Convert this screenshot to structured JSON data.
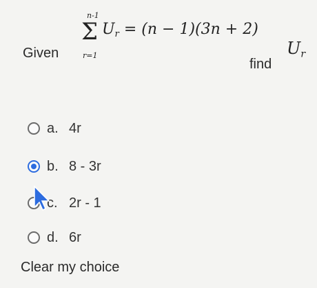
{
  "question": {
    "given_label": "Given",
    "sum_upper": "n-1",
    "sum_symbol": "Σ",
    "sum_lower": "r=1",
    "expression_term": "U",
    "expression_sub": "r",
    "expression_rhs": "= (n − 1)(3n + 2)",
    "find_label": "find",
    "target_term": "U",
    "target_sub": "r"
  },
  "options": [
    {
      "letter": "a.",
      "text": "4r",
      "selected": false
    },
    {
      "letter": "b.",
      "text": "8 - 3r",
      "selected": true
    },
    {
      "letter": "c.",
      "text": "2r - 1",
      "selected": false
    },
    {
      "letter": "d.",
      "text": "6r",
      "selected": false
    }
  ],
  "clear_label": "Clear my choice",
  "colors": {
    "accent": "#2d6cdf",
    "background": "#f4f4f2"
  }
}
